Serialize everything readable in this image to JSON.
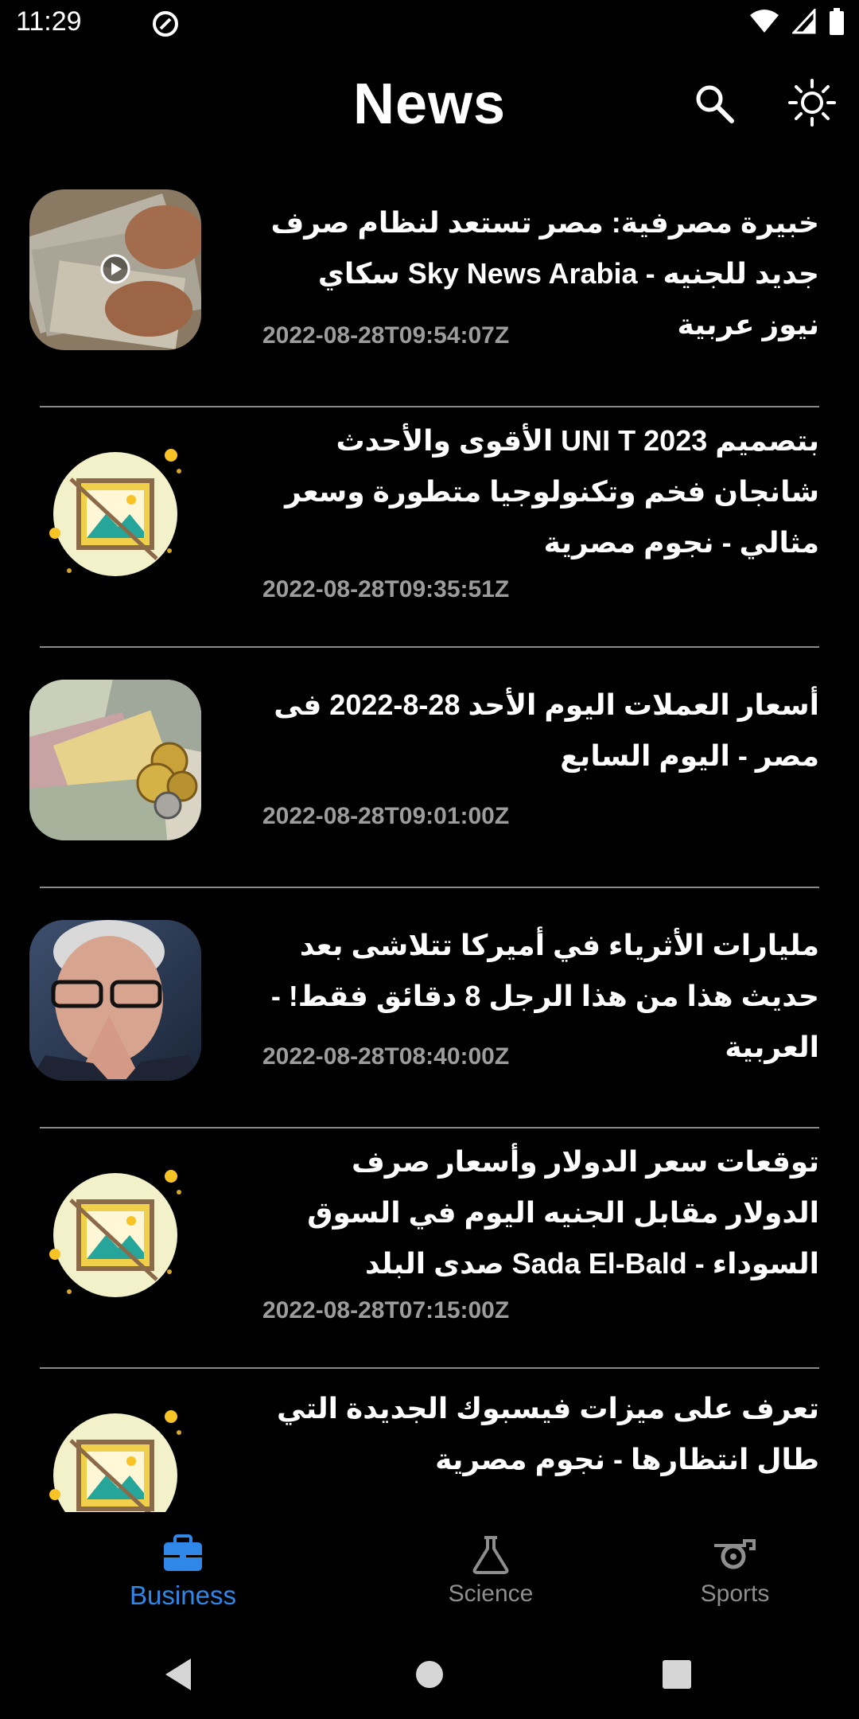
{
  "status_bar": {
    "time": "11:29"
  },
  "app_bar": {
    "title": "News",
    "search_icon": "search-icon",
    "theme_icon": "brightness-icon"
  },
  "news": [
    {
      "title": "خبيرة مصرفية: مصر تستعد لنظام صرف جديد للجنيه - Sky News Arabia سكاي نيوز عربية",
      "date": "2022-08-28T09:54:07Z",
      "thumbnail": "photo-egyptian-banknotes"
    },
    {
      "title": "بتصميم UNI T 2023 الأقوى والأحدث شانجان فخم وتكنولوجيا متطورة وسعر مثالي - نجوم مصرية",
      "date": "2022-08-28T09:35:51Z",
      "thumbnail": "no-image-placeholder"
    },
    {
      "title": "أسعار العملات اليوم الأحد 28-8-2022 فى مصر - اليوم السابع",
      "date": "2022-08-28T09:01:00Z",
      "thumbnail": "photo-currencies"
    },
    {
      "title": "مليارات الأثرياء في أميركا تتلاشى بعد حديث هذا من هذا الرجل 8 دقائق فقط! - العربية",
      "date": "2022-08-28T08:40:00Z",
      "thumbnail": "photo-man-portrait"
    },
    {
      "title": "توقعات سعر الدولار وأسعار صرف الدولار مقابل الجنيه اليوم في السوق السوداء - Sada El-Bald صدى البلد",
      "date": "2022-08-28T07:15:00Z",
      "thumbnail": "no-image-placeholder"
    },
    {
      "title": "تعرف على ميزات فيسبوك الجديدة التي طال انتظارها - نجوم مصرية",
      "date": "",
      "thumbnail": "no-image-placeholder"
    }
  ],
  "bottom_nav": {
    "items": [
      {
        "label": "Business",
        "icon": "briefcase-icon",
        "active": true
      },
      {
        "label": "Science",
        "icon": "flask-icon",
        "active": false
      },
      {
        "label": "Sports",
        "icon": "whistle-icon",
        "active": false
      }
    ]
  },
  "colors": {
    "background": "#000000",
    "accent": "#2f88e8",
    "muted": "#9c9c9c",
    "divider": "#8a8a8a"
  }
}
